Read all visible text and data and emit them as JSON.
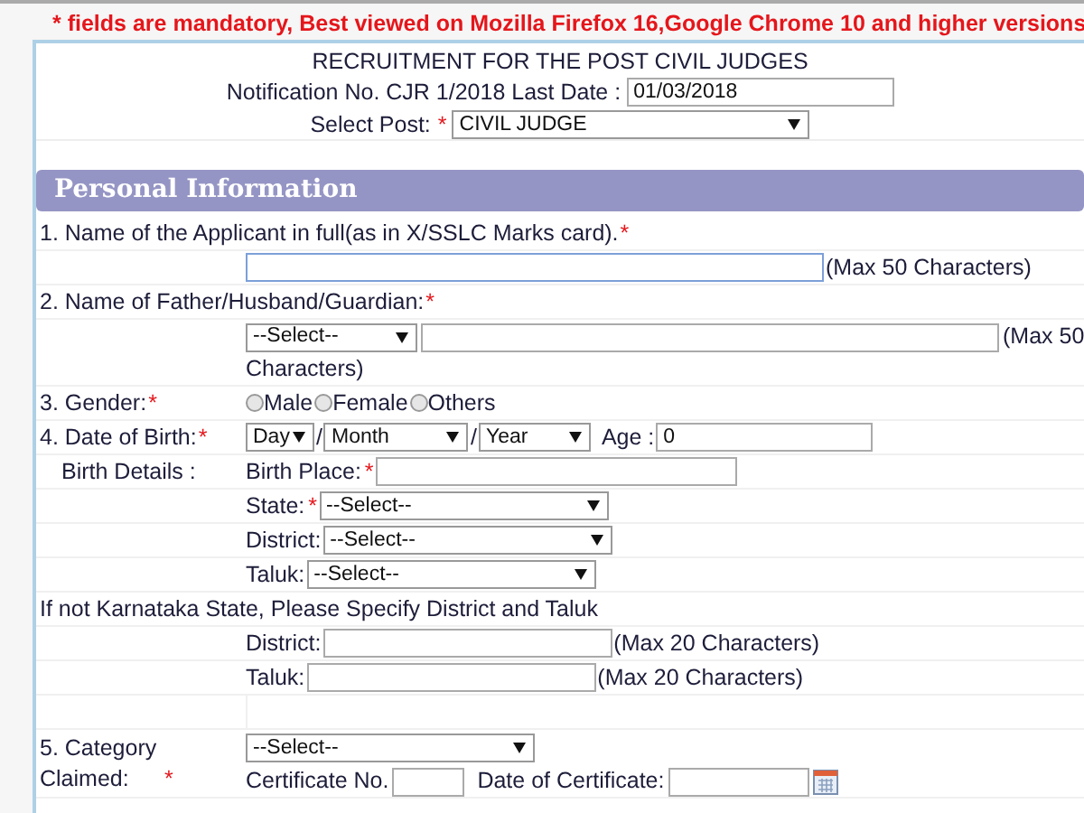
{
  "notice": "* fields are mandatory, Best viewed on Mozilla Firefox 16,Google Chrome 10 and higher versions",
  "title": "RECRUITMENT FOR THE POST CIVIL JUDGES",
  "notification": {
    "label": "Notification No. CJR 1/2018 Last Date :",
    "value": "01/03/2018"
  },
  "post": {
    "label": "Select Post:",
    "mark": "*",
    "value": "CIVIL JUDGE"
  },
  "section_title": "Personal Information",
  "applicant_name": {
    "label": "1. Name of the Applicant in full(as in X/SSLC Marks card).",
    "mark": "*",
    "hint": "(Max 50 Characters)"
  },
  "guardian_name": {
    "label": "2. Name of Father/Husband/Guardian:",
    "mark": "*",
    "select": "--Select--",
    "hint_start": "(Max 50",
    "hint_end": "Characters)"
  },
  "gender": {
    "label": "3. Gender:",
    "mark": "*",
    "options": [
      {
        "label": "Male",
        "selected": false
      },
      {
        "label": "Female",
        "selected": false
      },
      {
        "label": "Others",
        "selected": false
      }
    ]
  },
  "dob": {
    "label": "4. Date of Birth:",
    "mark": "*",
    "day": "Day",
    "separator_1": "/",
    "month": "Month",
    "separator_2": "/",
    "year": "Year",
    "age_label": "Age :",
    "age_value": "0"
  },
  "birth_details": {
    "label": "Birth Details :",
    "birth_place": {
      "label": "Birth Place:",
      "mark": "*"
    },
    "selects": [
      {
        "label": "State:",
        "mark": "*",
        "value": "--Select--"
      },
      {
        "label": "District:",
        "value": "--Select--"
      },
      {
        "label": "Taluk:",
        "value": "--Select--"
      }
    ]
  },
  "other_state_note": "If not Karnataka State, Please Specify District and Taluk",
  "other_state_fields": [
    {
      "label": "District:",
      "hint": "(Max 20 Characters)"
    },
    {
      "label": "Taluk:",
      "hint": "(Max 20 Characters)"
    }
  ],
  "category": {
    "label": "5. Category Claimed:",
    "mark": "*",
    "select": "--Select--",
    "certificate_no_label": "Certificate No.",
    "certificate_date_label": "Date of Certificate:"
  }
}
